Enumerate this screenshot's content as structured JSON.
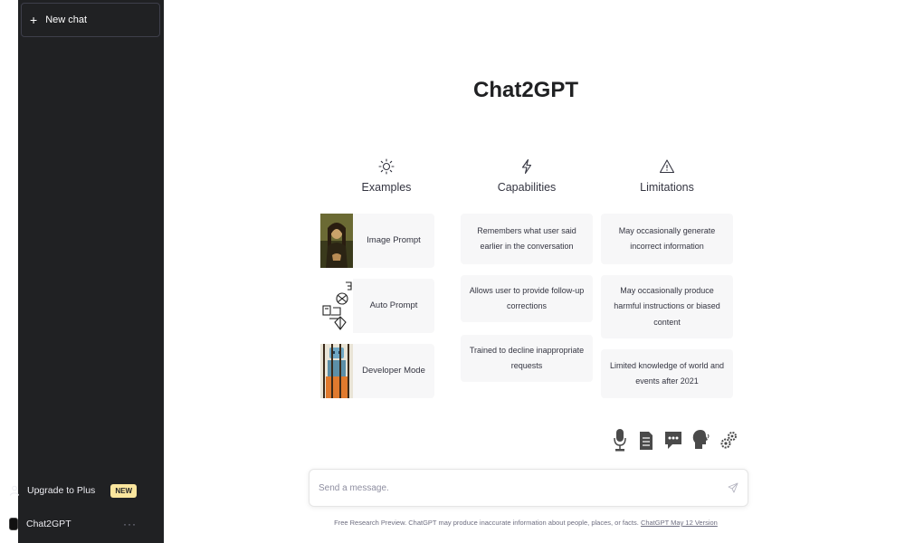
{
  "sidebar": {
    "new_chat_label": "New chat",
    "upgrade_label": "Upgrade to Plus",
    "upgrade_badge": "NEW",
    "account_name": "Chat2GPT",
    "account_menu": "···"
  },
  "main": {
    "title": "Chat2GPT",
    "columns": [
      {
        "icon": "sun-icon",
        "title": "Examples",
        "items": [
          {
            "label": "Image Prompt",
            "thumb": "mona-lisa-thumbnail"
          },
          {
            "label": "Auto Prompt",
            "thumb": "robot-sketch-thumbnail"
          },
          {
            "label": "Developer Mode",
            "thumb": "robot-prison-thumbnail"
          }
        ]
      },
      {
        "icon": "lightning-icon",
        "title": "Capabilities",
        "items": [
          "Remembers what user said earlier in the conversation",
          "Allows user to provide follow-up corrections",
          "Trained to decline inappropriate requests"
        ]
      },
      {
        "icon": "warning-icon",
        "title": "Limitations",
        "items": [
          "May occasionally generate incorrect information",
          "May occasionally produce harmful instructions or biased content",
          "Limited knowledge of world and events after 2021"
        ]
      }
    ],
    "toolbar": [
      "microphone-icon",
      "document-icon",
      "chat-bubble-icon",
      "voice-head-icon",
      "settings-gears-icon"
    ],
    "input": {
      "placeholder": "Send a message.",
      "value": ""
    },
    "footer": {
      "text": "Free Research Preview. ChatGPT may produce inaccurate information about people, places, or facts. ",
      "link": "ChatGPT May 12 Version"
    }
  },
  "colors": {
    "sidebar_bg": "#202123",
    "card_bg": "#f7f7f8",
    "badge_bg": "#fae69e",
    "text": "#343541"
  }
}
